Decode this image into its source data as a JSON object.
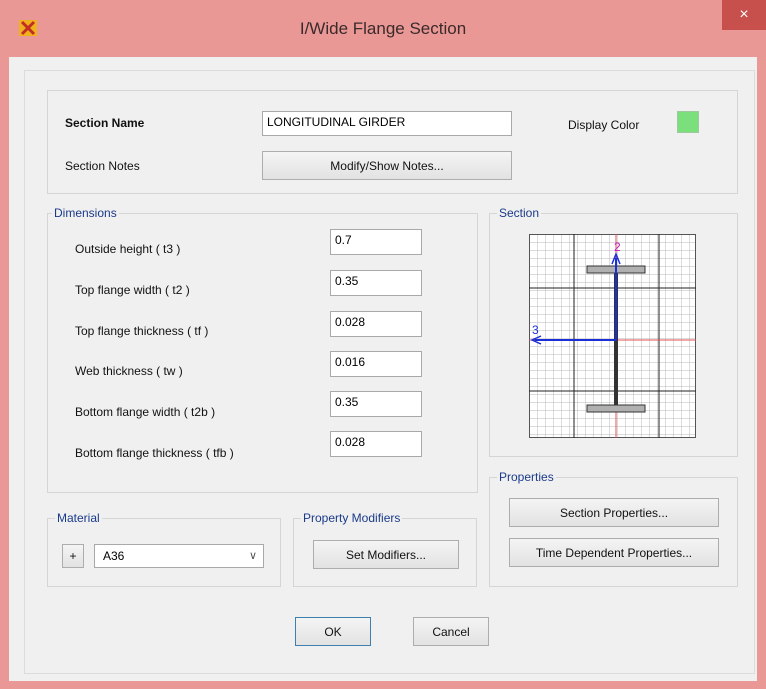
{
  "window": {
    "title": "I/Wide Flange Section",
    "close_glyph": "×"
  },
  "section": {
    "name_label": "Section Name",
    "name_value": "LONGITUDINAL GIRDER",
    "notes_label": "Section Notes",
    "notes_button": "Modify/Show Notes...",
    "display_color_label": "Display Color",
    "display_color": "#7be07b"
  },
  "dimensions": {
    "title": "Dimensions",
    "fields": [
      {
        "label": "Outside height  ( t3 )",
        "value": "0.7"
      },
      {
        "label": "Top flange width  ( t2 )",
        "value": "0.35"
      },
      {
        "label": "Top flange thickness  ( tf )",
        "value": "0.028"
      },
      {
        "label": "Web thickness  ( tw )",
        "value": "0.016"
      },
      {
        "label": "Bottom flange width  ( t2b )",
        "value": "0.35"
      },
      {
        "label": "Bottom flange thickness  ( tfb )",
        "value": "0.028"
      }
    ]
  },
  "section_preview": {
    "title": "Section",
    "axis_vertical": "2",
    "axis_horizontal": "3"
  },
  "properties": {
    "title": "Properties",
    "section_properties_button": "Section Properties...",
    "time_dependent_button": "Time Dependent Properties..."
  },
  "material": {
    "title": "Material",
    "add_glyph": "+",
    "selected": "A36",
    "dropdown_glyph": "∨"
  },
  "modifiers": {
    "title": "Property Modifiers",
    "button": "Set Modifiers..."
  },
  "footer": {
    "ok": "OK",
    "cancel": "Cancel"
  }
}
